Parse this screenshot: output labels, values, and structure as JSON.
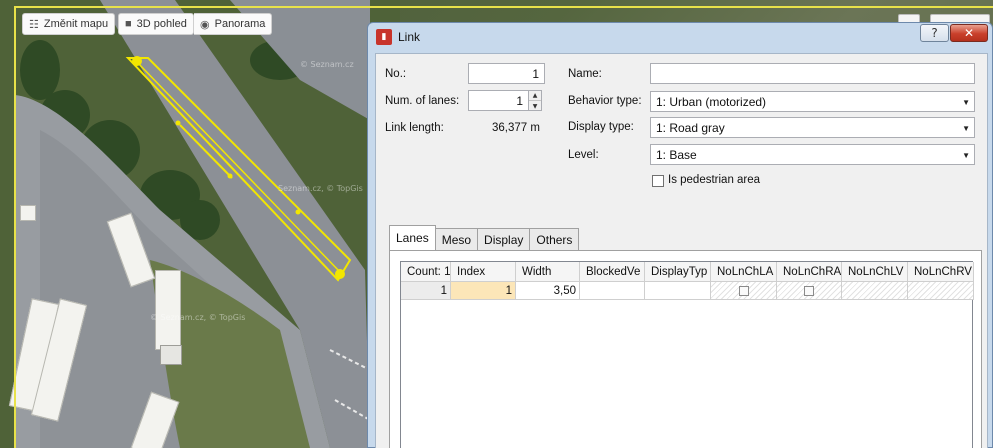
{
  "map": {
    "buttons": [
      {
        "label": "Změnit mapu",
        "icon": "map-layers-icon"
      },
      {
        "label": "3D pohled",
        "icon": "cube-icon"
      },
      {
        "label": "Panorama",
        "icon": "eye-icon"
      }
    ],
    "watermarks": [
      "© Seznam.cz",
      "Seznam.cz, © TopGis",
      "© Seznam.cz, © TopGis"
    ],
    "link_color": "#f2e600"
  },
  "dialog": {
    "title": "Link",
    "help_label": "?",
    "close_label": "✕",
    "fields": {
      "no_label": "No.:",
      "no_value": "1",
      "lanes_label": "Num. of lanes:",
      "lanes_value": "1",
      "length_label": "Link length:",
      "length_value": "36,377 m",
      "name_label": "Name:",
      "name_value": "",
      "behavior_label": "Behavior type:",
      "behavior_value": "1: Urban (motorized)",
      "display_label": "Display type:",
      "display_value": "1: Road gray",
      "level_label": "Level:",
      "level_value": "1: Base",
      "pedestrian_label": "Is pedestrian area",
      "pedestrian_checked": false
    },
    "tabs": [
      "Lanes",
      "Meso",
      "Display",
      "Others"
    ],
    "active_tab": "Lanes",
    "grid": {
      "headers": [
        "Count: 1",
        "Index",
        "Width",
        "BlockedVe",
        "DisplayTyp",
        "NoLnChLA",
        "NoLnChRA",
        "NoLnChLV",
        "NoLnChRV"
      ],
      "rows": [
        {
          "count": "1",
          "index": "1",
          "width": "3,50",
          "blocked": "",
          "display": ""
        }
      ]
    }
  }
}
